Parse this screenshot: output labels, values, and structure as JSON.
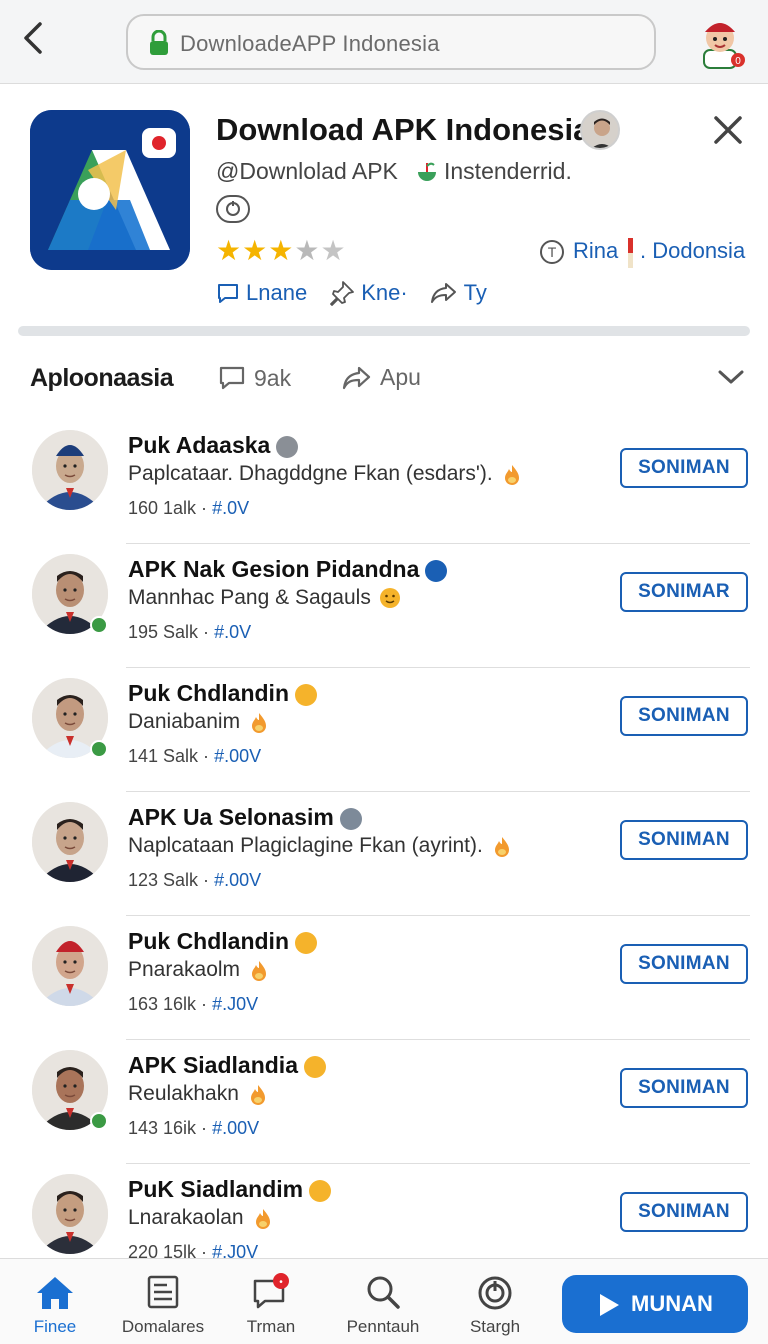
{
  "address_bar": {
    "url_text": "DownloadeAPP Indonesia"
  },
  "app": {
    "title": "Download APK Indonesia",
    "publisher": "@Downlolad APK",
    "install_note": "Instenderrid.",
    "rating_stars": 3.5,
    "region_prefix": "Rina",
    "region_suffix": ". Dodonsia",
    "actions": [
      {
        "label": "Lnane",
        "icon": "chat-icon"
      },
      {
        "label": "Kne·",
        "icon": "pin-icon"
      },
      {
        "label": "Ty",
        "icon": "share-icon"
      }
    ]
  },
  "section": {
    "title": "Aploonaasia",
    "chat_count": "9ak",
    "share_label": "Apu"
  },
  "rows": [
    {
      "name": "Puk Adaaska",
      "desc": "Paplcataar. Dhagddgne Fkan (esdars').",
      "meta": "160 1alk ·",
      "ver": "#.0V",
      "button": "SONIMAN",
      "skin": "#c9a98e",
      "shirt": "#2a4d8f",
      "hat": "#1d3d7a",
      "badge": false
    },
    {
      "name": "APK Nak Gesion Pidandna",
      "desc": "Mannhac Pang & Sagauls",
      "meta": "195 Salk ·",
      "ver": "#.0V",
      "button": "SONIMAR",
      "skin": "#b98f74",
      "shirt": "#232a3a",
      "hat": "",
      "badge": true
    },
    {
      "name": "Puk Chdlandin",
      "desc": "Daniabanim",
      "meta": "141 Salk ·",
      "ver": "#.00V",
      "button": "SONIMAN",
      "skin": "#c29a80",
      "shirt": "#e8eef5",
      "hat": "",
      "badge": true
    },
    {
      "name": "APK Ua Selonasim",
      "desc": "Naplcataan Plagiclagine Fkan (ayrint).",
      "meta": "123 Salk ·",
      "ver": "#.00V",
      "button": "SONIMAN",
      "skin": "#c7a48b",
      "shirt": "#1f2433",
      "hat": "",
      "badge": false
    },
    {
      "name": "Puk Chdlandin",
      "desc": "Pnarakaolm",
      "meta": "163 16lk ·",
      "ver": "#.J0V",
      "button": "SONIMAN",
      "skin": "#d1a58c",
      "shirt": "#cfd9e8",
      "hat": "#c2222b",
      "badge": false
    },
    {
      "name": "APK Siadlandia",
      "desc": "Reulakhakn",
      "meta": "143 16ik ·",
      "ver": "#.00V",
      "button": "SONIMAN",
      "skin": "#a9745a",
      "shirt": "#2c2c2c",
      "hat": "",
      "badge": true
    },
    {
      "name": "PuK Siadlandim",
      "desc": "Lnarakaolan",
      "meta": "220 15lk ·",
      "ver": "#.J0V",
      "button": "SONIMAN",
      "skin": "#c49d80",
      "shirt": "#2b2f3a",
      "hat": "",
      "badge": false
    }
  ],
  "nav": [
    {
      "label": "Finee",
      "icon": "home-icon",
      "active": true
    },
    {
      "label": "Domalares",
      "icon": "document-icon",
      "active": false
    },
    {
      "label": "Trman",
      "icon": "chat-notification-icon",
      "active": false
    },
    {
      "label": "Penntauh",
      "icon": "search-icon",
      "active": false
    },
    {
      "label": "Stargh",
      "icon": "power-icon",
      "active": false
    }
  ],
  "primary_button": "MUNAN",
  "colors": {
    "accent": "#1a6fd1",
    "link": "#1a5fb4",
    "star": "#f5b400",
    "app_icon_bg": "#0d3a8c"
  }
}
